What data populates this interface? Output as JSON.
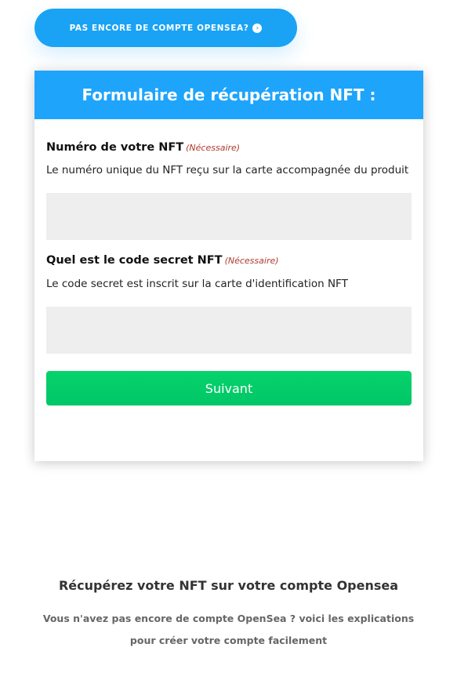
{
  "cta": {
    "label": "PAS ENCORE DE COMPTE OPENSEA?",
    "icon": "arrow-circle-right-icon",
    "icon_glyph": "›",
    "color": "#1aa3f5"
  },
  "form": {
    "title": "Formulaire de récupération NFT :",
    "header_color": "#1ea4fb",
    "fields": [
      {
        "label": "Numéro de votre NFT",
        "required": "(Nécessaire)",
        "description": "Le numéro unique du NFT reçu sur la carte accompagnée du produit",
        "value": "",
        "placeholder": ""
      },
      {
        "label": "Quel est le code secret NFT",
        "required": "(Nécessaire)",
        "description": "Le code secret est inscrit sur la carte d'identification NFT",
        "value": "",
        "placeholder": ""
      }
    ],
    "submit_label": "Suivant",
    "submit_color": "#00c96a"
  },
  "footer": {
    "title": "Récupérez votre NFT sur votre compte Opensea",
    "text": "Vous n'avez pas encore de compte OpenSea ? voici les explications pour créer votre compte facilement"
  }
}
